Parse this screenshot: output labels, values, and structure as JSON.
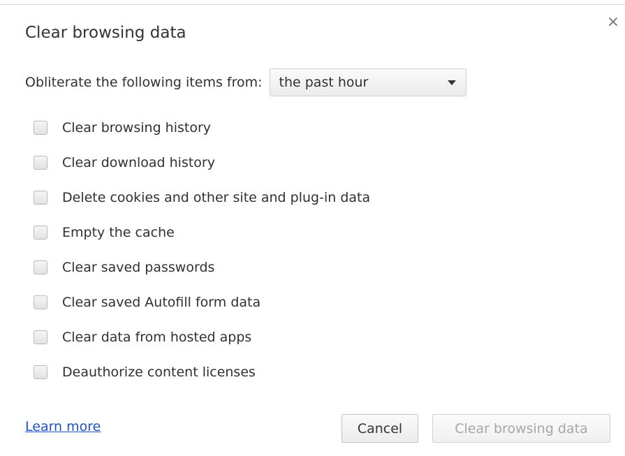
{
  "dialog": {
    "title": "Clear browsing data",
    "close_glyph": "×",
    "close_icon": "close-icon"
  },
  "range": {
    "label": "Obliterate the following items from:",
    "selected": "the past hour",
    "arrow_icon": "dropdown-arrow-icon"
  },
  "options": [
    {
      "label": "Clear browsing history",
      "checked": false
    },
    {
      "label": "Clear download history",
      "checked": false
    },
    {
      "label": "Delete cookies and other site and plug-in data",
      "checked": false
    },
    {
      "label": "Empty the cache",
      "checked": false
    },
    {
      "label": "Clear saved passwords",
      "checked": false
    },
    {
      "label": "Clear saved Autofill form data",
      "checked": false
    },
    {
      "label": "Clear data from hosted apps",
      "checked": false
    },
    {
      "label": "Deauthorize content licenses",
      "checked": false
    }
  ],
  "footer": {
    "learn_more": "Learn more",
    "cancel_label": "Cancel",
    "clear_label": "Clear browsing data",
    "clear_enabled": false
  },
  "colors": {
    "link": "#1a52c4",
    "disabled_text": "#a6a6a6",
    "text": "#303030"
  }
}
